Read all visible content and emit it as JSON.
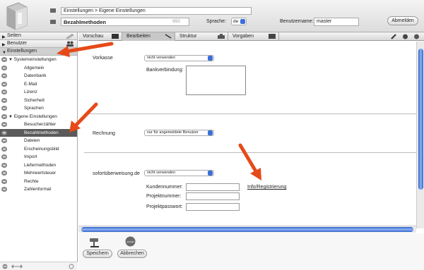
{
  "header": {
    "breadcrumb": "Einstellungen > Eigene Einstellungen",
    "title": "Bezahlmethoden",
    "count": "950",
    "language_label": "Sprache:",
    "language_value": "de",
    "username_label": "Benutzername:",
    "username_value": "master",
    "logout_label": "Abmelden"
  },
  "sidebar": {
    "sections": [
      {
        "label": "Seiten"
      },
      {
        "label": "Benutzer"
      },
      {
        "label": "Einstellungen"
      }
    ],
    "tree": [
      {
        "label": "Systemeinstellungen"
      },
      {
        "label": "Allgemein"
      },
      {
        "label": "Datenbank"
      },
      {
        "label": "E-Mail"
      },
      {
        "label": "Lizenz"
      },
      {
        "label": "Sicherheit"
      },
      {
        "label": "Sprachen"
      },
      {
        "label": "Eigene Einstellungen"
      },
      {
        "label": "Besucherzähler"
      },
      {
        "label": "Bezahlmethoden"
      },
      {
        "label": "Dateien"
      },
      {
        "label": "Erscheinungsbild"
      },
      {
        "label": "Import"
      },
      {
        "label": "Liefermethoden"
      },
      {
        "label": "Mehrwertsteuer"
      },
      {
        "label": "Rechte"
      },
      {
        "label": "Zahlenformat"
      }
    ]
  },
  "tabs": [
    {
      "label": "Vorschau"
    },
    {
      "label": "Bearbeiten"
    },
    {
      "label": "Struktur"
    },
    {
      "label": "Vorgaben"
    }
  ],
  "content": {
    "vorkasse_label": "Vorkasse",
    "vorkasse_value": "nicht verwenden",
    "bank_label": "Bankverbindung:",
    "rechnung_label": "Rechnung",
    "rechnung_value": "nur für angemeldete Benutzer",
    "sofort_label": "sofortüberweisung.de",
    "sofort_value": "nicht verwenden",
    "kunden_label": "Kundennummer:",
    "projekt_label": "Projektnummer:",
    "passwort_label": "Projektpasswort:",
    "info_link": "Info/Registrierung"
  },
  "footer": {
    "save_label": "Speichern",
    "cancel_label": "Abbrechen"
  },
  "colors": {
    "accent": "#3a6fd8",
    "arrow": "#e64a19",
    "selected_bg": "#5a5a5a"
  }
}
